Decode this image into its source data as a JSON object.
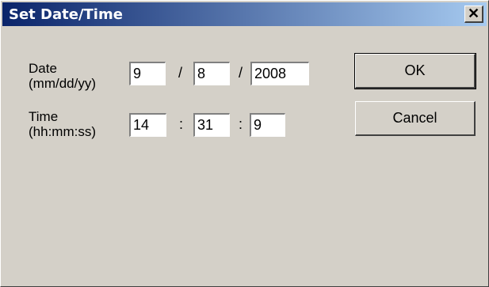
{
  "window": {
    "title": "Set Date/Time",
    "close_glyph": "✕",
    "title_colors": {
      "start": "#0a246a",
      "end": "#a6caf0"
    },
    "face_color": "#d4d0c8"
  },
  "date": {
    "label_line1": "Date",
    "label_line2": "(mm/dd/yy)",
    "month": "9",
    "day": "8",
    "year": "2008",
    "separator": "/"
  },
  "time": {
    "label_line1": "Time",
    "label_line2": "(hh:mm:ss)",
    "hour": "14",
    "minute": "31",
    "second": "9",
    "separator": ":"
  },
  "buttons": {
    "ok_label": "OK",
    "cancel_label": "Cancel"
  }
}
